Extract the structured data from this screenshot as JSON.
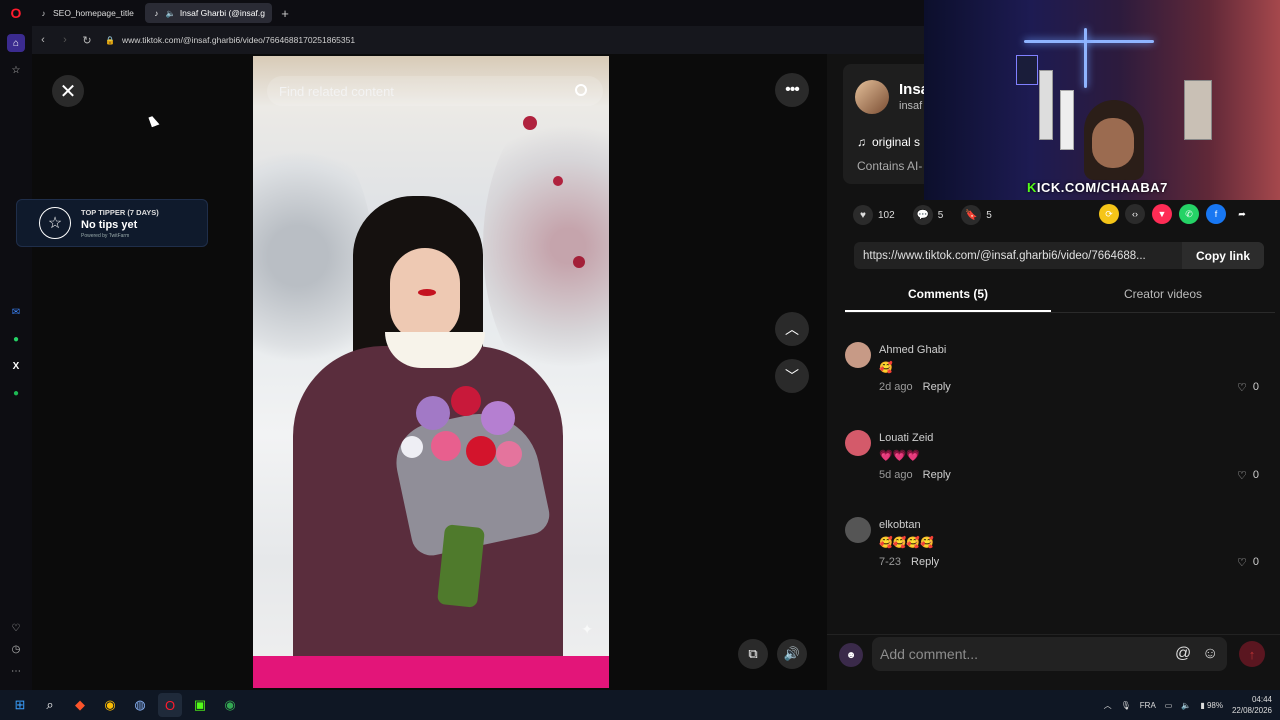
{
  "browser": {
    "tabs": [
      {
        "label": "SEO_homepage_title",
        "active": false
      },
      {
        "label": "Insaf Gharbi (@insaf.g",
        "active": true
      }
    ],
    "url": "www.tiktok.com/@insaf.gharbi6/video/7664688170251865351"
  },
  "video": {
    "search_placeholder": "Find related content"
  },
  "tipper": {
    "heading": "TOP TIPPER (7 DAYS)",
    "value": "No tips yet",
    "powered": "Powered by TwitFarm"
  },
  "creator": {
    "name": "Insaf",
    "handle": "insaf",
    "music": "original s",
    "ai_note": "Contains AI-"
  },
  "actions": {
    "likes": "102",
    "comments": "5",
    "saves": "5"
  },
  "link": {
    "url": "https://www.tiktok.com/@insaf.gharbi6/video/7664688...",
    "copy_label": "Copy link"
  },
  "panel_tabs": {
    "comments": "Comments (5)",
    "creator_videos": "Creator videos"
  },
  "comments": [
    {
      "user": "Ahmed Ghabi",
      "text": "🥰",
      "time": "2d ago",
      "reply": "Reply",
      "likes": "0",
      "avatar_color": "#c79a86"
    },
    {
      "user": "Louati Zeid",
      "text": "💗💗💗",
      "time": "5d ago",
      "reply": "Reply",
      "likes": "0",
      "avatar_color": "#d45a6a"
    },
    {
      "user": "elkobtan",
      "text": "🥰🥰🥰🥰",
      "time": "7-23",
      "reply": "Reply",
      "likes": "0",
      "avatar_color": "#555555"
    }
  ],
  "comment_bar": {
    "placeholder": "Add comment..."
  },
  "stream": {
    "kick_prefix": "K",
    "kick_rest": "ICK.COM/CHAABA7"
  },
  "taskbar": {
    "language": "FRA",
    "battery": "98%",
    "time": "04:44",
    "date": "22/08/2026"
  },
  "icons": {
    "close": "close-icon",
    "more": "more-icon",
    "up": "chevron-up-icon",
    "down": "chevron-down-icon"
  },
  "colors": {
    "brand_red": "#fe2c55",
    "kick_green": "#53fc18",
    "opera_red": "#ff1b2d"
  }
}
